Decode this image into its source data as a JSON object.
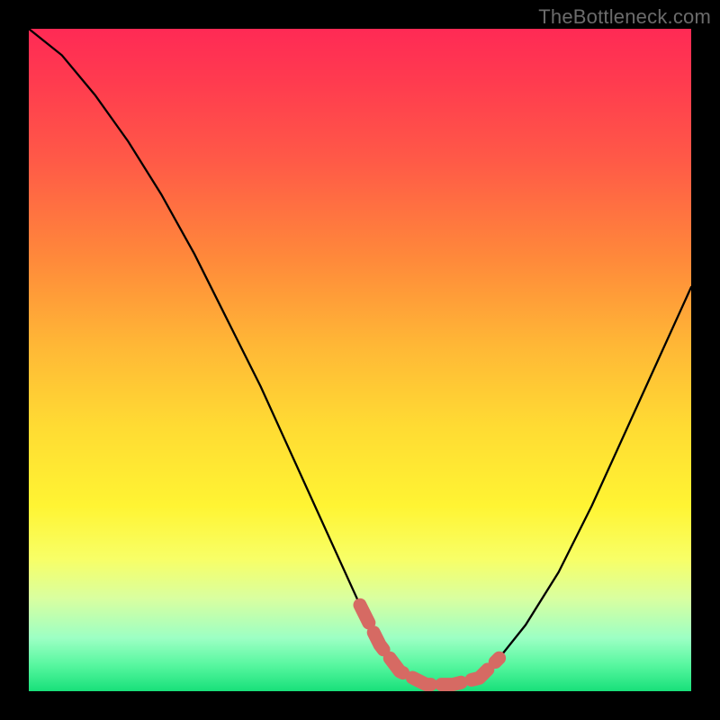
{
  "watermark": "TheBottleneck.com",
  "chart_data": {
    "type": "line",
    "title": "",
    "xlabel": "",
    "ylabel": "",
    "xlim": [
      0,
      100
    ],
    "ylim": [
      0,
      100
    ],
    "series": [
      {
        "name": "bottleneck-curve",
        "x": [
          0,
          5,
          10,
          15,
          20,
          25,
          30,
          35,
          40,
          45,
          50,
          53,
          56,
          60,
          64,
          68,
          71,
          75,
          80,
          85,
          90,
          95,
          100
        ],
        "values": [
          100,
          96,
          90,
          83,
          75,
          66,
          56,
          46,
          35,
          24,
          13,
          7,
          3,
          1,
          1,
          2,
          5,
          10,
          18,
          28,
          39,
          50,
          61
        ]
      },
      {
        "name": "highlight-band",
        "x": [
          50,
          53,
          56,
          60,
          64,
          68,
          71
        ],
        "values": [
          13,
          7,
          3,
          1,
          1,
          2,
          5
        ]
      }
    ],
    "colors": {
      "curve": "#000000",
      "highlight": "#d66a63"
    }
  }
}
